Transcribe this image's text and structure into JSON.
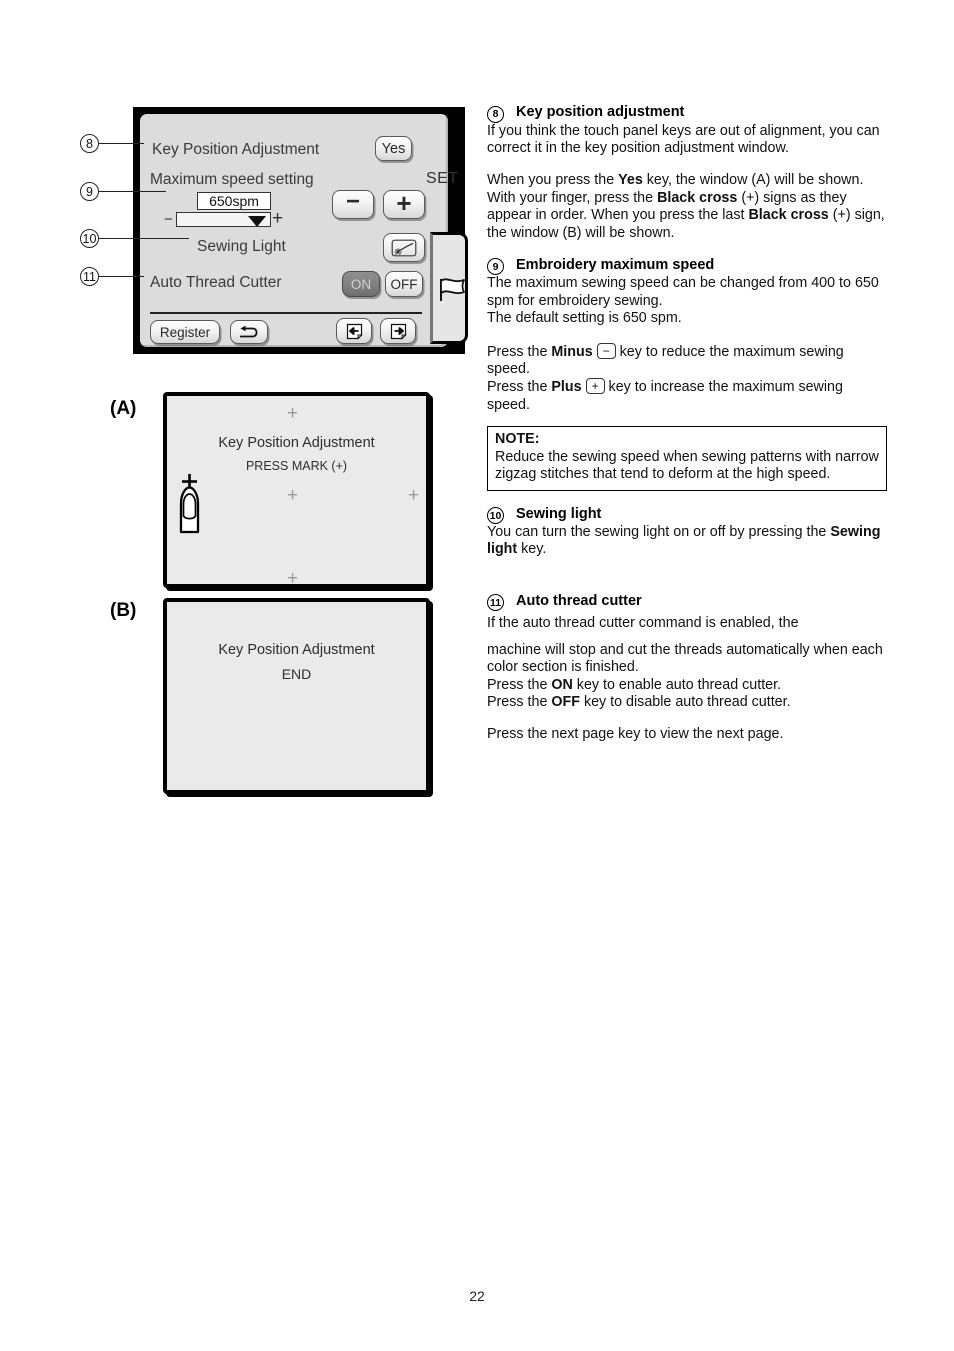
{
  "panel": {
    "rows": {
      "key_position_adjustment": "Key Position Adjustment",
      "maximum_speed_setting": "Maximum speed setting",
      "sewing_light": "Sewing Light",
      "auto_thread_cutter": "Auto Thread Cutter"
    },
    "keys": {
      "yes": "Yes",
      "minus": "−",
      "plus": "+",
      "on": "ON",
      "off": "OFF",
      "register": "Register",
      "set_label": "SET"
    },
    "speed": {
      "value": "650spm",
      "minus_sign": "−",
      "plus_sign": "+"
    },
    "callouts": [
      "8",
      "9",
      "10",
      "11"
    ]
  },
  "windows": {
    "a": {
      "tag": "(A)",
      "title": "Key Position Adjustment",
      "subtitle": "PRESS MARK (+)",
      "cross": "+"
    },
    "b": {
      "tag": "(B)",
      "title": "Key Position Adjustment",
      "subtitle": "END"
    }
  },
  "sections": [
    {
      "num": "8",
      "heading": "Key position adjustment",
      "paragraphs": [
        "If you think the touch panel keys are out of alignment, you can correct it in the key position adjustment window."
      ]
    },
    {
      "num": "9",
      "heading": "Embroidery maximum speed",
      "paragraphs": [
        "The maximum sewing speed can be changed from 400 to 650 spm for embroidery sewing.",
        "The default setting is 650 spm."
      ]
    },
    {
      "num": "10",
      "heading": "Sewing light",
      "paragraphs": [
        "You can turn the sewing light on or off by pressing the"
      ]
    },
    {
      "num": "11",
      "heading": "Auto thread cutter",
      "paragraphs": [
        "If the auto thread cutter command is enabled, the",
        "machine will stop and cut the threads automatically when each color section is finished."
      ]
    }
  ],
  "body_text": {
    "yes_para_1": "When you press the ",
    "yes_bold": "Yes",
    "yes_para_2": " key, the window (A) will be shown. With your finger, press the ",
    "blackcross_bold_1": "Black cross",
    "yes_para_3": " (+) signs as they appear in order. When you press the last ",
    "blackcross_bold_2": "Black cross",
    "yes_para_4": " (+) sign, the window (B) will be shown.",
    "press_minus_1": "Press the ",
    "minus_bold": "Minus",
    "minus_key_glyph": "−",
    "press_minus_2": " key to reduce the maximum sewing speed.",
    "press_plus_1": "Press the ",
    "plus_bold": "Plus",
    "plus_key_glyph": "+",
    "press_plus_2": " key to increase the maximum sewing speed.",
    "sewing_light_bold": "Sewing light",
    "sewing_light_tail": " key.",
    "press_on_1": "Press the ",
    "on_bold": "ON",
    "press_on_2": " key to enable auto thread cutter.",
    "press_off_1": "Press the ",
    "off_bold": "OFF",
    "press_off_2": " key to disable auto thread cutter.",
    "next_page": "Press the next page key to view the next page."
  },
  "note": {
    "label": "NOTE:",
    "text": "Reduce the sewing speed when sewing patterns with narrow zigzag stitches that tend to deform at the high speed."
  },
  "page": {
    "number": "22"
  }
}
